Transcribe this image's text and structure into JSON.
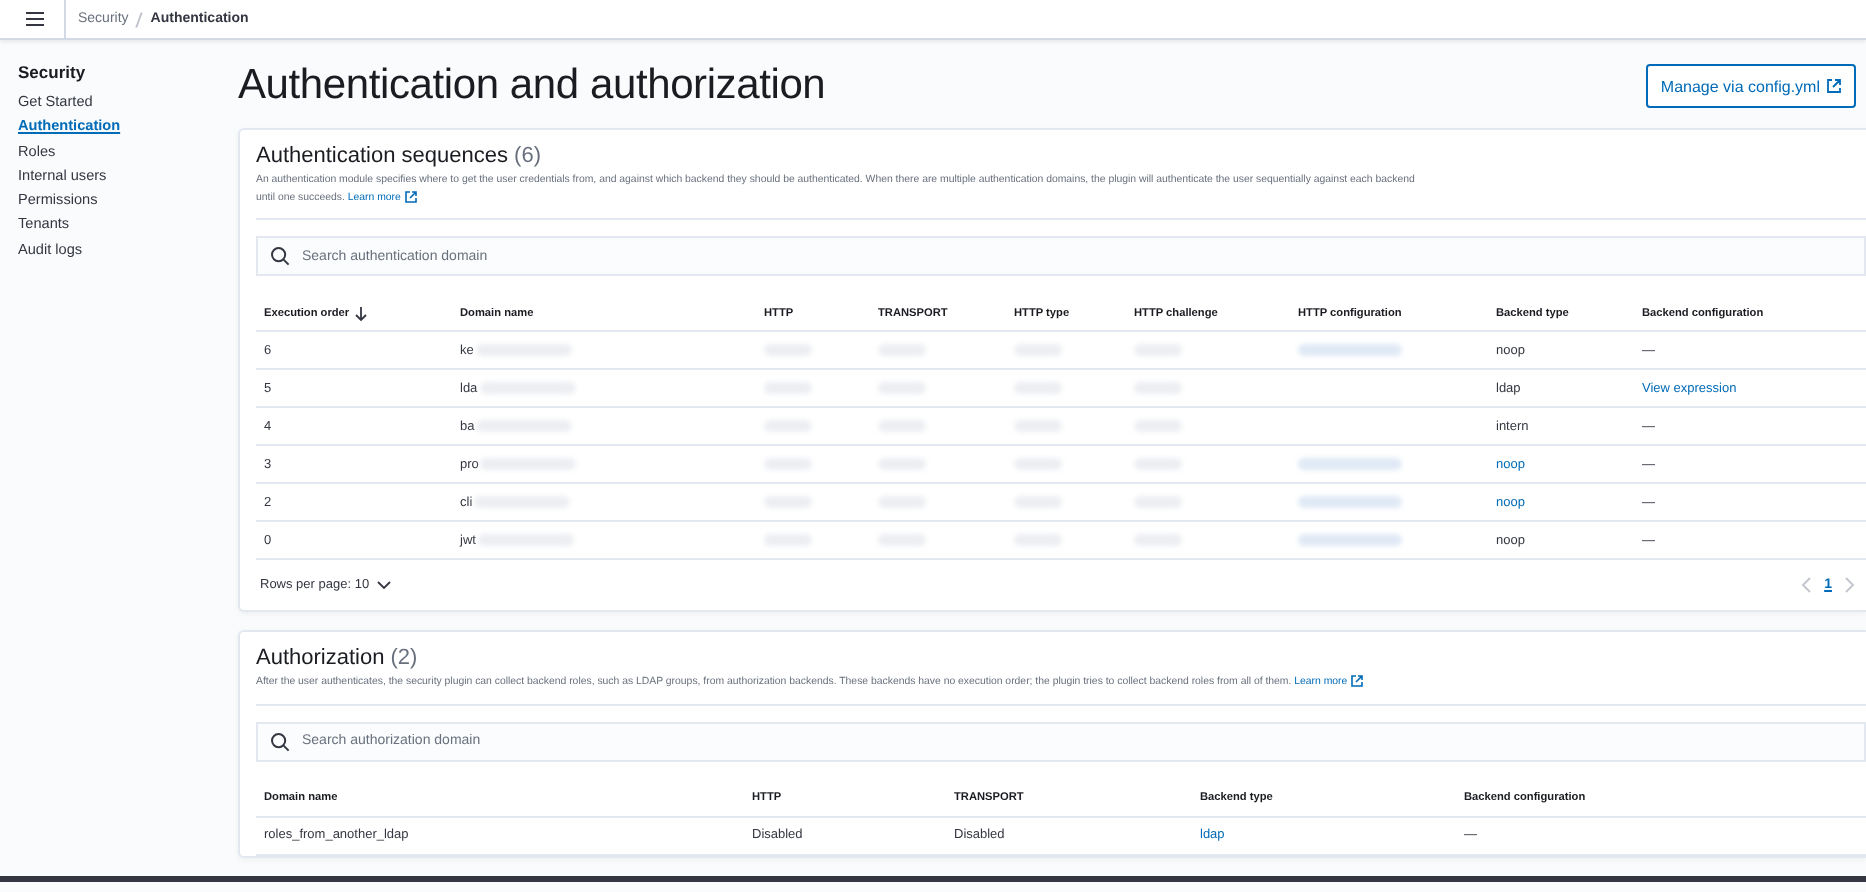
{
  "breadcrumbs": [
    {
      "label": "Security",
      "selected": false
    },
    {
      "label": "Authentication",
      "selected": true
    }
  ],
  "sidebar": {
    "title": "Security",
    "items": [
      {
        "label": "Get Started",
        "selected": false
      },
      {
        "label": "Authentication",
        "selected": true
      },
      {
        "label": "Roles",
        "selected": false
      },
      {
        "label": "Internal users",
        "selected": false
      },
      {
        "label": "Permissions",
        "selected": false
      },
      {
        "label": "Tenants",
        "selected": false
      },
      {
        "label": "Audit logs",
        "selected": false
      }
    ]
  },
  "page_title": "Authentication and authorization",
  "manage_button": "Manage via config.yml",
  "sections": [
    {
      "title": "Authentication sequences",
      "count": "(6)",
      "description": "An authentication module specifies where to get the user credentials from, and against which backend they should be authenticated. When there are multiple authentication domains, the plugin will authenticate the user sequentially against each backend until one succeeds.",
      "learn_more": "Learn more",
      "search_placeholder": "Search authentication domain",
      "columns": [
        {
          "label": "Execution order",
          "sorted": true
        },
        {
          "label": "Domain name",
          "sorted": false
        },
        {
          "label": "HTTP",
          "sorted": false
        },
        {
          "label": "TRANSPORT",
          "sorted": false
        },
        {
          "label": "HTTP type",
          "sorted": false
        },
        {
          "label": "HTTP challenge",
          "sorted": false
        },
        {
          "label": "HTTP configuration",
          "sorted": false
        },
        {
          "label": "Backend type",
          "sorted": false
        },
        {
          "label": "Backend configuration",
          "sorted": false
        }
      ],
      "rows": [
        [
          {
            "kind": "text",
            "text": "6"
          },
          {
            "kind": "partial",
            "text": "ke"
          },
          {
            "kind": "blurred"
          },
          {
            "kind": "blurred"
          },
          {
            "kind": "blurred"
          },
          {
            "kind": "blurred"
          },
          {
            "kind": "blurred-link"
          },
          {
            "kind": "text",
            "text": "noop"
          },
          {
            "kind": "text",
            "text": "—"
          }
        ],
        [
          {
            "kind": "text",
            "text": "5"
          },
          {
            "kind": "partial",
            "text": "lda"
          },
          {
            "kind": "blurred"
          },
          {
            "kind": "blurred"
          },
          {
            "kind": "blurred"
          },
          {
            "kind": "blurred"
          },
          {
            "kind": "empty"
          },
          {
            "kind": "text",
            "text": "ldap"
          },
          {
            "kind": "link",
            "text": "View expression"
          }
        ],
        [
          {
            "kind": "text",
            "text": "4"
          },
          {
            "kind": "partial",
            "text": "ba"
          },
          {
            "kind": "blurred"
          },
          {
            "kind": "blurred"
          },
          {
            "kind": "blurred"
          },
          {
            "kind": "blurred"
          },
          {
            "kind": "empty"
          },
          {
            "kind": "text",
            "text": "intern"
          },
          {
            "kind": "text",
            "text": "—"
          }
        ],
        [
          {
            "kind": "text",
            "text": "3"
          },
          {
            "kind": "partial",
            "text": "pro"
          },
          {
            "kind": "blurred"
          },
          {
            "kind": "blurred"
          },
          {
            "kind": "blurred"
          },
          {
            "kind": "blurred"
          },
          {
            "kind": "blurred-link"
          },
          {
            "kind": "link",
            "text": "noop"
          },
          {
            "kind": "text",
            "text": "—"
          }
        ],
        [
          {
            "kind": "text",
            "text": "2"
          },
          {
            "kind": "partial",
            "text": "cli"
          },
          {
            "kind": "blurred"
          },
          {
            "kind": "blurred"
          },
          {
            "kind": "blurred"
          },
          {
            "kind": "blurred"
          },
          {
            "kind": "blurred-link"
          },
          {
            "kind": "link",
            "text": "noop"
          },
          {
            "kind": "text",
            "text": "—"
          }
        ],
        [
          {
            "kind": "text",
            "text": "0"
          },
          {
            "kind": "partial",
            "text": "jwt"
          },
          {
            "kind": "blurred"
          },
          {
            "kind": "blurred"
          },
          {
            "kind": "blurred"
          },
          {
            "kind": "blurred"
          },
          {
            "kind": "blurred-link"
          },
          {
            "kind": "text",
            "text": "noop"
          },
          {
            "kind": "text",
            "text": "—"
          }
        ]
      ],
      "footer": {
        "rows_per_page": "Rows per page: 10",
        "pages": [
          {
            "label": "1",
            "selected": true
          }
        ]
      }
    },
    {
      "title": "Authorization",
      "count": "(2)",
      "description": "After the user authenticates, the security plugin can collect backend roles, such as LDAP groups, from authorization backends. These backends have no execution order; the plugin tries to collect backend roles from all of them.",
      "learn_more": "Learn more",
      "search_placeholder": "Search authorization domain",
      "columns": [
        {
          "label": "Domain name",
          "sorted": false
        },
        {
          "label": "HTTP",
          "sorted": false
        },
        {
          "label": "TRANSPORT",
          "sorted": false
        },
        {
          "label": "Backend type",
          "sorted": false
        },
        {
          "label": "Backend configuration",
          "sorted": false
        }
      ],
      "rows": [
        [
          {
            "kind": "text",
            "text": "roles_from_another_ldap"
          },
          {
            "kind": "text",
            "text": "Disabled"
          },
          {
            "kind": "text",
            "text": "Disabled"
          },
          {
            "kind": "link",
            "text": "ldap"
          },
          {
            "kind": "text",
            "text": "—"
          }
        ]
      ]
    }
  ]
}
